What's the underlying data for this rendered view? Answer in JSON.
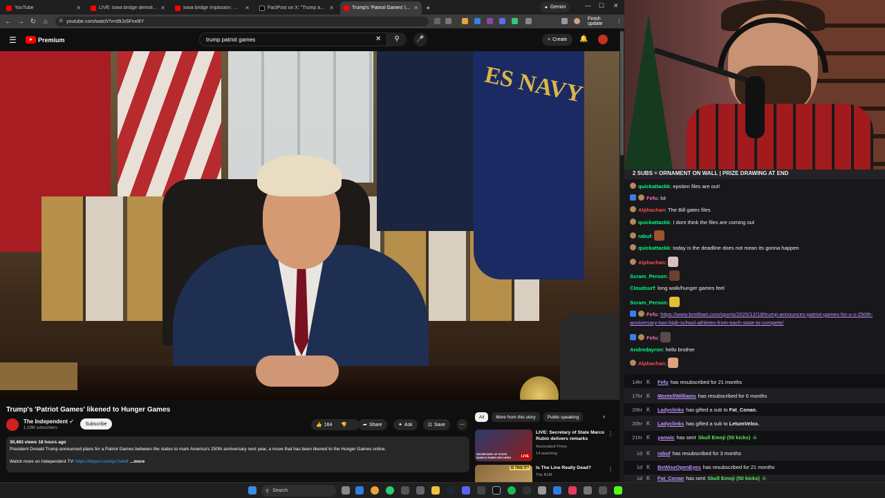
{
  "browser": {
    "tabs": [
      {
        "title": "YouTube",
        "color": "#ff0000",
        "active": false
      },
      {
        "title": "LIVE: Iowa bridge demolition: I...",
        "color": "#ff0000",
        "active": false
      },
      {
        "title": "Iowa bridge Implosion: Watch t...",
        "color": "#ff0000",
        "active": false
      },
      {
        "title": "FactPost on X: \"Trump anno...",
        "color": "#000000",
        "active": false
      },
      {
        "title": "Trump's 'Patriot Games' lik...",
        "color": "#ff0000",
        "active": true
      }
    ],
    "new_tab": "+",
    "gemini": "Gemini",
    "url": "youtube.com/watch?v=d9Jx5Fnx8lY",
    "finish_update": "Finish update"
  },
  "youtube": {
    "logo_text": "Premium",
    "search_value": "trump patriot games",
    "create_label": "Create",
    "video": {
      "title": "Trump's 'Patriot Games' likened to Hunger Games",
      "channel": "The Independent",
      "subscribers": "1.19M subscribers",
      "subscribe": "Subscribe",
      "likes": "164",
      "share": "Share",
      "ask": "Ask",
      "save": "Save",
      "navy_text": "ES NAVY",
      "meta": "30,483 views  18 hours ago",
      "description": "President Donald Trump announced plans for a Patriot Games between the states to mark America's 250th anniversary next year, a move that has been likened to the Hunger Games online.",
      "watch_more": "Watch more on Independent TV:",
      "watch_link": "https://tinyurl.com/yc7ukvfr",
      "more": "...more"
    },
    "chips": [
      "All",
      "More from this story",
      "Public speaking"
    ],
    "recommendations": [
      {
        "title": "LIVE: Secretary of State Marco Rubio delivers remarks",
        "channel": "Associated Press",
        "meta": "14 watching",
        "badge": "LIVE",
        "thumb_text": "SECRETARY OF STATE MARCO RUBIO DELIVERS"
      },
      {
        "title": "Is The Line Really Dead?",
        "channel": "The B1M",
        "meta": "",
        "badge": "",
        "thumb_text": "IS THIS IT?"
      }
    ]
  },
  "chat": {
    "banner": "2 SUBS = ORNAMENT ON WALL | PRIZE DRAWING AT END",
    "messages": [
      {
        "user": "quickattackk",
        "color": "#00ff7f",
        "text": "epstien files are out!"
      },
      {
        "user": "Fefu",
        "color": "#ff69b4",
        "text": "lol"
      },
      {
        "user": "Alphachan",
        "color": "#ff4a4a",
        "text": "The Bill gates files"
      },
      {
        "user": "quickattackk",
        "color": "#00ff7f",
        "text": "I dont think the files are coming out"
      },
      {
        "user": "rabuf",
        "color": "#00ff7f",
        "text": ""
      },
      {
        "user": "quickattackk",
        "color": "#00ff7f",
        "text": "today is the deadline does not mean its gonna happen"
      },
      {
        "user": "Alphachan",
        "color": "#ff4a4a",
        "text": ""
      },
      {
        "user": "Scram_Person",
        "color": "#00ff7f",
        "text": ""
      },
      {
        "user": "Cloudsurf",
        "color": "#00ff7f",
        "text": "long walk/hunger games feel"
      },
      {
        "user": "Scram_Person",
        "color": "#00ff7f",
        "text": ""
      },
      {
        "user": "Fefu",
        "color": "#ff69b4",
        "text": "https://www.breitbart.com/sports/2025/12/18/trump-announces-patriot-games-for-u-s-250th-anniversary-two-high-school-athletes-from-each-state-to-compete/"
      },
      {
        "user": "Fefu",
        "color": "#ff69b4",
        "text": ""
      },
      {
        "user": "Andredayron",
        "color": "#00ff7f",
        "text": "hello brother"
      },
      {
        "user": "Alphachan",
        "color": "#ff4a4a",
        "text": ""
      }
    ],
    "events": [
      {
        "time": "14hr",
        "user": "Fefu",
        "text": "has resubscribed for 21 months",
        "extra": "",
        "tail": ""
      },
      {
        "time": "17hr",
        "user": "MontellWilliams",
        "text": "has resubscribed for 6 months",
        "extra": "",
        "tail": ""
      },
      {
        "time": "20hr",
        "user": "Ladyclinks",
        "text": "has gifted a sub to",
        "extra": "Fat_Conan.",
        "tail": ""
      },
      {
        "time": "20hr",
        "user": "Ladyclinks",
        "text": "has gifted a sub to",
        "extra": "LetumVelox.",
        "tail": ""
      },
      {
        "time": "21hr",
        "user": "yanwic",
        "text": "has sent",
        "extra": "",
        "tail": "Skull Emoji (50 kicks)"
      },
      {
        "time": "1d",
        "user": "rabuf",
        "text": "has resubscribed for 3 months",
        "extra": "",
        "tail": ""
      },
      {
        "time": "1d",
        "user": "BeWiseOpenEyes",
        "text": "has resubscribed for 21 months",
        "extra": "",
        "tail": ""
      },
      {
        "time": "1d",
        "user": "Fat_Conan",
        "text": "has sent",
        "extra": "",
        "tail": "Skull Emoji (50 kicks)"
      }
    ]
  },
  "taskbar": {
    "search_placeholder": "Search"
  }
}
